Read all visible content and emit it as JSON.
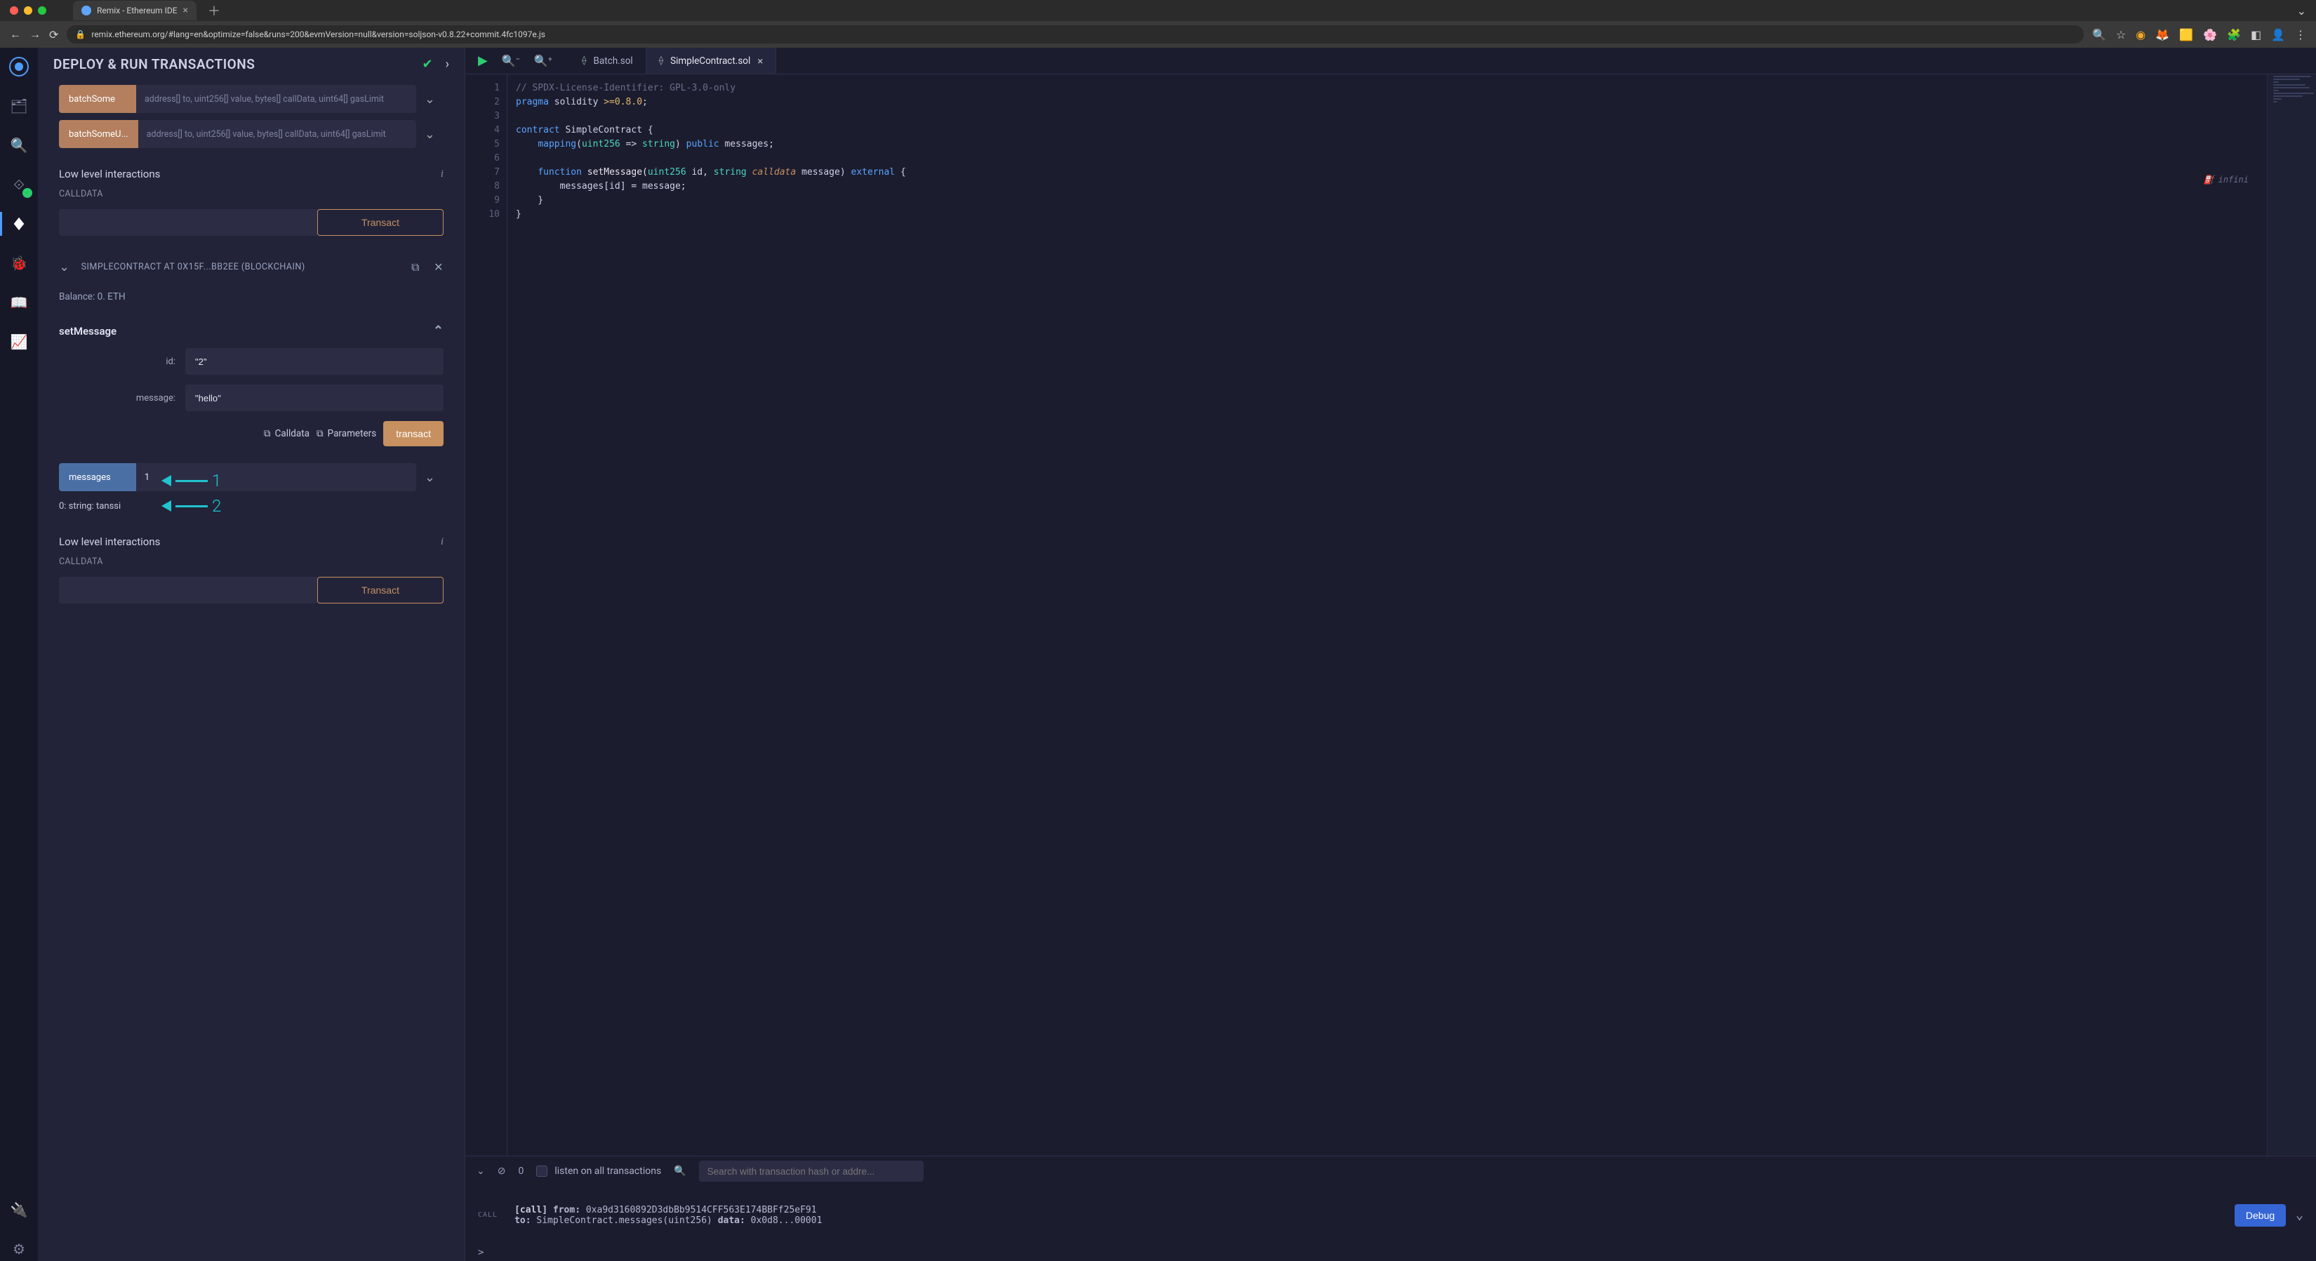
{
  "browser": {
    "tab_title": "Remix - Ethereum IDE",
    "url": "remix.ethereum.org/#lang=en&optimize=false&runs=200&evmVersion=null&version=soljson-v0.8.22+commit.4fc1097e.js"
  },
  "panel": {
    "title": "DEPLOY & RUN TRANSACTIONS",
    "fns": {
      "batchSome": {
        "label": "batchSome",
        "args": "address[] to, uint256[] value, bytes[] callData, uint64[] gasLimit"
      },
      "batchSomeU": {
        "label": "batchSomeU...",
        "args": "address[] to, uint256[] value, bytes[] callData, uint64[] gasLimit"
      }
    },
    "low_level_title": "Low level interactions",
    "calldata_label": "CALLDATA",
    "transact_btn": "Transact",
    "instance": {
      "name": "SIMPLECONTRACT AT 0X15F...BB2EE (BLOCKCHAIN)",
      "balance": "Balance: 0. ETH"
    },
    "setMessage": {
      "title": "setMessage",
      "id_label": "id:",
      "id_value": "\"2\"",
      "msg_label": "message:",
      "msg_value": "\"hello\"",
      "calldata_btn": "Calldata",
      "params_btn": "Parameters",
      "transact_btn": "transact"
    },
    "messages": {
      "label": "messages",
      "input": "1",
      "result": "0: string: tanssi"
    },
    "annot": {
      "one": "1",
      "two": "2"
    }
  },
  "editor": {
    "tabs": {
      "batch": "Batch.sol",
      "simple": "SimpleContract.sol"
    },
    "gas_hint": "infini",
    "code_lines": {
      "1": "// SPDX-License-Identifier: GPL-3.0-only",
      "2a": "pragma",
      "2b": " solidity ",
      "2c": ">=0.8.0",
      "2d": ";",
      "4a": "contract",
      "4b": " SimpleContract {",
      "5a": "mapping",
      "5b": "uint256",
      "5c": "string",
      "5d": "public",
      "5e": " messages;",
      "7a": "function",
      "7b": " setMessage(",
      "7c": "uint256",
      "7d": " id, ",
      "7e": "string",
      "7f": "calldata",
      "7g": " message",
      "7h": "external",
      "8": "        messages[id] = message;"
    }
  },
  "terminal": {
    "count": "0",
    "listen": "listen on all transactions",
    "search_placeholder": "Search with transaction hash or addre...",
    "tag": "CALL",
    "l1_call": "[call]",
    "l1_from": "from:",
    "l1_addr": "0xa9d3160892D3dbBb9514CFF563E174BBFf25eF91",
    "l2_to": "to:",
    "l2_sig": "SimpleContract.messages(uint256)",
    "l2_data": "data:",
    "l2_hex": "0x0d8...00001",
    "debug": "Debug",
    "prompt": ">"
  }
}
